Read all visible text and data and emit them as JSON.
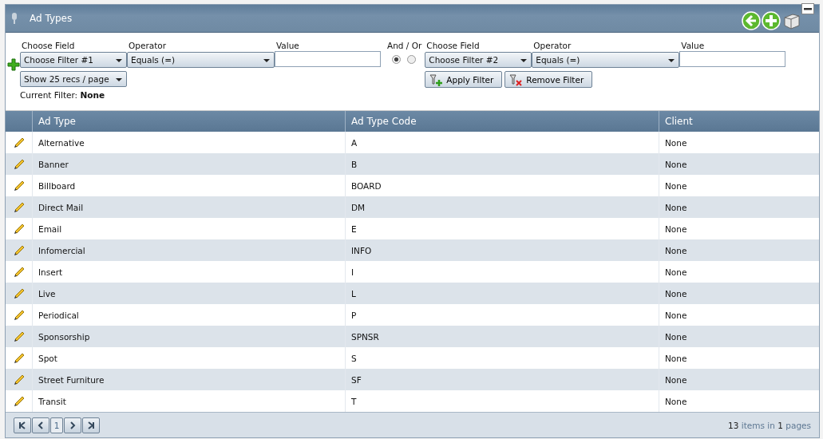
{
  "panel": {
    "title": "Ad Types"
  },
  "filter": {
    "and_or_label": "And / Or",
    "filter1": {
      "field_label": "Choose Field",
      "operator_label": "Operator",
      "value_label": "Value",
      "field": "Choose Filter #1",
      "operator": "Equals (=)"
    },
    "filter2": {
      "field_label": "Choose Field",
      "operator_label": "Operator",
      "value_label": "Value",
      "field": "Choose Filter #2",
      "operator": "Equals (=)"
    },
    "and_or": [
      {
        "selected": true
      },
      {
        "selected": false
      }
    ],
    "page_size": "Show 25 recs / page",
    "current_label": "Current Filter:",
    "current_value": "None",
    "apply": "Apply Filter",
    "remove": "Remove Filter"
  },
  "table": {
    "columns": [
      "Ad Type",
      "Ad Type Code",
      "Client"
    ],
    "rows": [
      {
        "ad_type": "Alternative",
        "code": "A",
        "client": "None"
      },
      {
        "ad_type": "Banner",
        "code": "B",
        "client": "None"
      },
      {
        "ad_type": "Billboard",
        "code": "BOARD",
        "client": "None"
      },
      {
        "ad_type": "Direct Mail",
        "code": "DM",
        "client": "None"
      },
      {
        "ad_type": "Email",
        "code": "E",
        "client": "None"
      },
      {
        "ad_type": "Infomercial",
        "code": "INFO",
        "client": "None"
      },
      {
        "ad_type": "Insert",
        "code": "I",
        "client": "None"
      },
      {
        "ad_type": "Live",
        "code": "L",
        "client": "None"
      },
      {
        "ad_type": "Periodical",
        "code": "P",
        "client": "None"
      },
      {
        "ad_type": "Sponsorship",
        "code": "SPNSR",
        "client": "None"
      },
      {
        "ad_type": "Spot",
        "code": "S",
        "client": "None"
      },
      {
        "ad_type": "Street Furniture",
        "code": "SF",
        "client": "None"
      },
      {
        "ad_type": "Transit",
        "code": "T",
        "client": "None"
      }
    ]
  },
  "pager": {
    "current_page": "1",
    "items_count": "13",
    "items_text": "items in",
    "pages_count": "1",
    "pages_text": "pages"
  }
}
